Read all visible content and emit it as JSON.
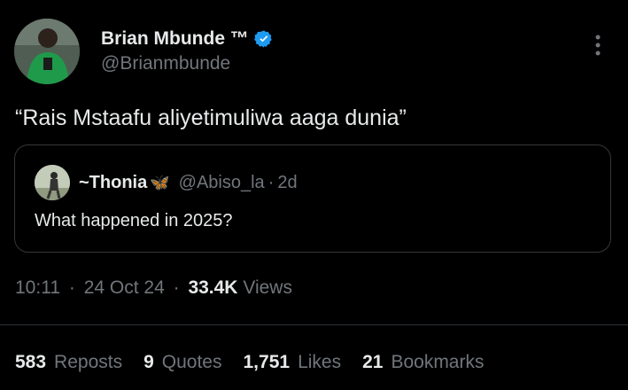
{
  "author": {
    "display_name": "Brian Mbunde ™",
    "handle": "@Brianmbunde",
    "avatar_icon": "profile-photo",
    "verified_icon": "verified-badge-icon",
    "verified_color": "#1d9bf0"
  },
  "more_icon": "more-vertical-icon",
  "tweet": {
    "text": "“Rais Mstaafu aliyetimuliwa aaga dunia”"
  },
  "quote": {
    "display_name": "~Thonia",
    "emoji": "🦋",
    "handle": "@Abiso_la",
    "dot": "·",
    "time": "2d",
    "text": "What happened in 2025?"
  },
  "meta": {
    "time": "10:11",
    "dot": "·",
    "date": "24 Oct 24",
    "views_count": "33.4K",
    "views_label": "Views"
  },
  "stats": [
    {
      "count": "583",
      "label": "Reposts"
    },
    {
      "count": "9",
      "label": "Quotes"
    },
    {
      "count": "1,751",
      "label": "Likes"
    },
    {
      "count": "21",
      "label": "Bookmarks"
    }
  ],
  "colors": {
    "background": "#000000",
    "text_primary": "#e7e9ea",
    "text_secondary": "#71767b",
    "border": "#333639"
  }
}
